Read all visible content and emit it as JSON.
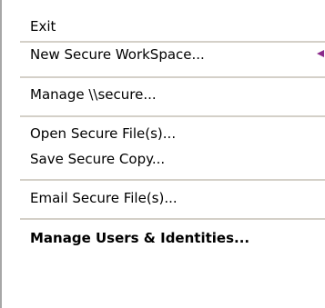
{
  "menu": {
    "items": [
      {
        "label": "Exit"
      },
      {
        "label": "New Secure WorkSpace..."
      },
      {
        "label": "Manage \\\\secure..."
      },
      {
        "label": "Open Secure File(s)..."
      },
      {
        "label": "Save Secure Copy..."
      },
      {
        "label": "Email Secure File(s)..."
      },
      {
        "label": "Manage Users & Identities..."
      }
    ],
    "submenu_icon": "triangle-left-icon",
    "colors": {
      "background": "#ffffff",
      "separator": "#d4d0c8",
      "left_edge": "#a7a7a7",
      "arrow": "#8a2a8a"
    }
  }
}
